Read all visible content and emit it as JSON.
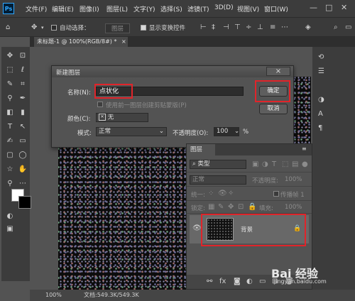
{
  "menubar": {
    "logo": "Ps",
    "items": [
      "文件(F)",
      "编辑(E)",
      "图像(I)",
      "图层(L)",
      "文字(Y)",
      "选择(S)",
      "滤镜(T)",
      "3D(D)",
      "视图(V)",
      "窗口(W)"
    ],
    "minimize": "—",
    "maximize": "□",
    "close": "✕"
  },
  "optionsbar": {
    "auto_select_label": "自动选择：",
    "auto_select_value": "图层",
    "show_transform_label": "显示变换控件"
  },
  "document": {
    "tab_title": "未标题-1 @ 100%(RGB/8#) *",
    "tab_close": "×",
    "zoom": "100%",
    "doc_info": "文档:549.3K/549.3K"
  },
  "dialog": {
    "title": "新建图层",
    "name_label": "名称(N):",
    "name_value": "点状化",
    "clip_label": "使用前一图层创建剪贴蒙版(P)",
    "color_label": "颜色(C):",
    "color_value": "无",
    "mode_label": "模式:",
    "mode_value": "正常",
    "opacity_label": "不透明度(O):",
    "opacity_value": "100",
    "opacity_unit": "%",
    "ok_label": "确定",
    "cancel_label": "取消",
    "close": "×"
  },
  "layers_panel": {
    "title": "图层",
    "filter_label": "类型",
    "blend_mode": "正常",
    "opacity_label": "不透明度:",
    "opacity_value": "100%",
    "unify_label": "统一:",
    "propagate_label": "传播帧 1",
    "lock_label": "锁定:",
    "fill_label": "填充:",
    "fill_value": "100%",
    "layer_name": "背景"
  },
  "watermark": {
    "text": "Bai 经验",
    "url": "jingyan.baidu.com"
  },
  "colors": {
    "highlight": "#e0242a",
    "panel": "#535353",
    "dark": "#3c3c3c"
  }
}
